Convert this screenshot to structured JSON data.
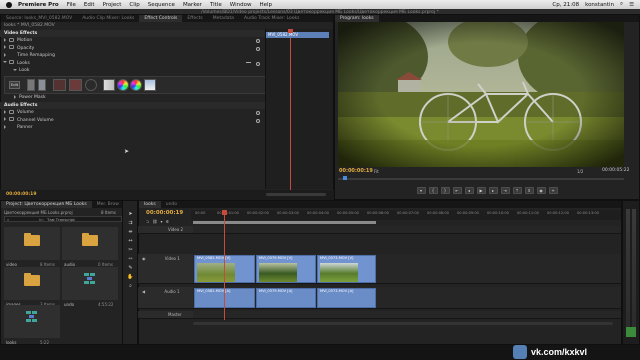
{
  "menubar": {
    "app": "Premiere Pro",
    "items": [
      "File",
      "Edit",
      "Project",
      "Clip",
      "Sequence",
      "Marker",
      "Title",
      "Window",
      "Help"
    ],
    "clock": "Ср, 21:08",
    "user": "konstantin"
  },
  "titlebar": {
    "text": "/Volumes/BD1/Video projects/Lessons/03 Цветокоррекция МБ Looks/Цветокоррекция МБ Looks.prproj *"
  },
  "fx_panel": {
    "tabs": [
      "Source: looks_MVI_0582.MOV",
      "Audio Clip Mixer: Looks",
      "Effect Controls",
      "Effects",
      "Metadata",
      "Audio Track Mixer: Looks"
    ],
    "active_tab": "Effect Controls",
    "clip_path": "looks * MVI_0582.MOV",
    "clip_bar_label": "MVI_0582.MOV",
    "rows": {
      "video_effects": "Video Effects",
      "motion": "Motion",
      "opacity": "Opacity",
      "time_remapping": "Time Remapping",
      "looks": "Looks",
      "look": "Look",
      "edit": "Edit",
      "power_mask": "Power Mask",
      "audio_effects": "Audio Effects",
      "volume": "Volume",
      "channel_volume": "Channel Volume",
      "panner": "Panner"
    },
    "timecode": "00:00:00:19"
  },
  "program": {
    "tab": "Program: looks",
    "timecode_left": "00:00:00:19",
    "fit": "Fit",
    "scale": "1/2",
    "timecode_right": "00:00:05:22"
  },
  "project": {
    "tabs": [
      "Project: Цветокоррекция МБ Looks",
      "Mer. Brow",
      "Info"
    ],
    "file": "Цветокоррекция МБ Looks.prproj",
    "items_count": "8 Items",
    "search_label": "In:",
    "search_value": "Там Тransсript",
    "bins": [
      {
        "name": "video",
        "count": "8 Items"
      },
      {
        "name": "audio",
        "count": "0 Items"
      },
      {
        "name": "images",
        "count": "3 Items"
      },
      {
        "name": "undo",
        "count": "4:55:22"
      },
      {
        "name": "looks",
        "count": "5:22"
      }
    ]
  },
  "timeline": {
    "tabs": [
      "looks",
      "undo"
    ],
    "timecode": "00:00:00:19",
    "ruler": [
      "00:00",
      "00:00:01:00",
      "00:00:02:00",
      "00:00:03:00",
      "00:00:04:00",
      "00:00:05:00",
      "00:00:06:00",
      "00:00:07:00",
      "00:00:08:00",
      "00:00:09:00",
      "00:00:10:00",
      "00:00:11:00",
      "00:00:12:00",
      "00:00:13:00"
    ],
    "tracks": {
      "v2": "Video 2",
      "v1": "Video 1",
      "a1": "Audio 1",
      "master": "Master"
    },
    "clips": [
      "MVI_0582.MOV [V]",
      "MVI_0579.MOV [V]",
      "MVI_0573.MOV [V]"
    ],
    "audio_clips": [
      "MVI_0582.MOV [A]",
      "MVI_0579.MOV [A]",
      "MVI_0573.MOV [A]"
    ]
  },
  "meters": {
    "labels": [
      "0",
      "-6",
      "-12",
      "-18",
      "-24",
      "-30",
      "-36",
      "-42",
      "-48",
      "-54"
    ]
  },
  "watermark": {
    "badge": "B",
    "text": "vk.com/kxkvl"
  },
  "colors": {
    "accent_timecode": "#e2ac3e",
    "clip_video": "#7193cf",
    "playhead": "#c74a3a",
    "vk_blue": "#5580b4"
  }
}
